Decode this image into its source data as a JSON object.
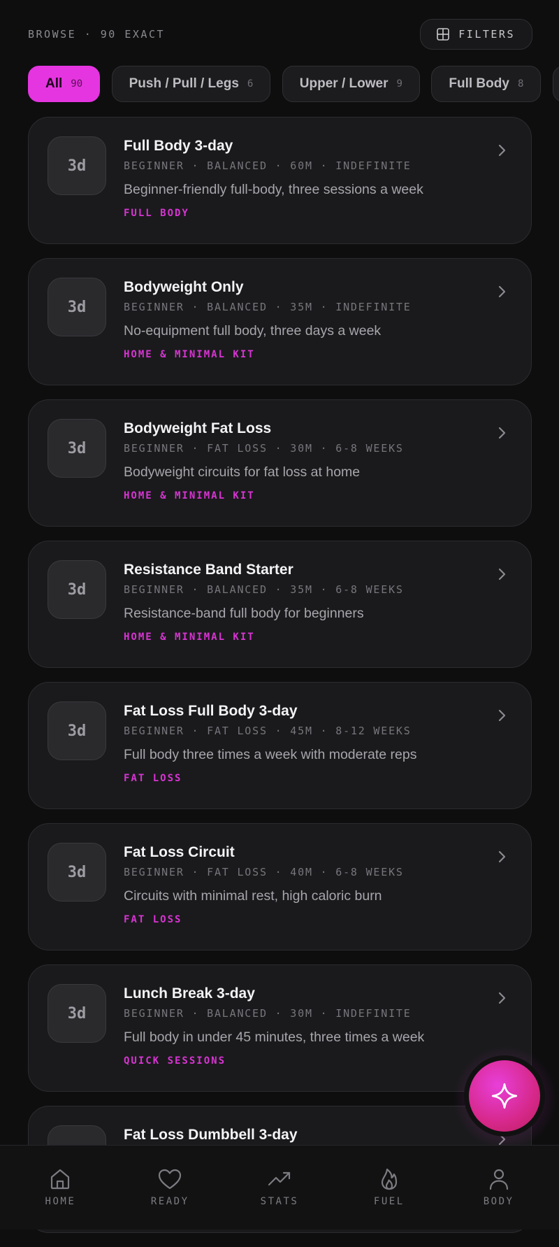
{
  "header": {
    "title": "BROWSE · 90 EXACT",
    "filters_label": "FILTERS"
  },
  "chips": [
    {
      "label": "All",
      "count": "90",
      "active": true
    },
    {
      "label": "Push / Pull / Legs",
      "count": "6",
      "active": false
    },
    {
      "label": "Upper / Lower",
      "count": "9",
      "active": false
    },
    {
      "label": "Full Body",
      "count": "8",
      "active": false
    },
    {
      "label": "",
      "count": "",
      "active": false
    }
  ],
  "programs": [
    {
      "days": "3d",
      "title": "Full Body 3-day",
      "meta": "BEGINNER · BALANCED · 60M · INDEFINITE",
      "description": "Beginner-friendly full-body, three sessions a week",
      "tag": "FULL BODY"
    },
    {
      "days": "3d",
      "title": "Bodyweight Only",
      "meta": "BEGINNER · BALANCED · 35M · INDEFINITE",
      "description": "No-equipment full body, three days a week",
      "tag": "HOME & MINIMAL KIT"
    },
    {
      "days": "3d",
      "title": "Bodyweight Fat Loss",
      "meta": "BEGINNER · FAT LOSS · 30M · 6-8 WEEKS",
      "description": "Bodyweight circuits for fat loss at home",
      "tag": "HOME & MINIMAL KIT"
    },
    {
      "days": "3d",
      "title": "Resistance Band Starter",
      "meta": "BEGINNER · BALANCED · 35M · 6-8 WEEKS",
      "description": "Resistance-band full body for beginners",
      "tag": "HOME & MINIMAL KIT"
    },
    {
      "days": "3d",
      "title": "Fat Loss Full Body 3-day",
      "meta": "BEGINNER · FAT LOSS · 45M · 8-12 WEEKS",
      "description": "Full body three times a week with moderate reps",
      "tag": "FAT LOSS"
    },
    {
      "days": "3d",
      "title": "Fat Loss Circuit",
      "meta": "BEGINNER · FAT LOSS · 40M · 6-8 WEEKS",
      "description": "Circuits with minimal rest, high caloric burn",
      "tag": "FAT LOSS"
    },
    {
      "days": "3d",
      "title": "Lunch Break 3-day",
      "meta": "BEGINNER · BALANCED · 30M · INDEFINITE",
      "description": "Full body in under 45 minutes, three times a week",
      "tag": "QUICK SESSIONS"
    },
    {
      "days": "",
      "title": "Fat Loss Dumbbell 3-day",
      "meta": "",
      "description": "",
      "tag": ""
    }
  ],
  "fab": {
    "icon": "sparkle-icon",
    "color": "#e535e0"
  },
  "nav": [
    {
      "label": "HOME",
      "icon": "home-icon"
    },
    {
      "label": "READY",
      "icon": "heart-icon"
    },
    {
      "label": "STATS",
      "icon": "trending-up-icon"
    },
    {
      "label": "FUEL",
      "icon": "flame-icon"
    },
    {
      "label": "BODY",
      "icon": "user-icon"
    }
  ],
  "colors": {
    "accent": "#e535e0",
    "background": "#0e0e0f",
    "card": "#1a1a1c"
  }
}
